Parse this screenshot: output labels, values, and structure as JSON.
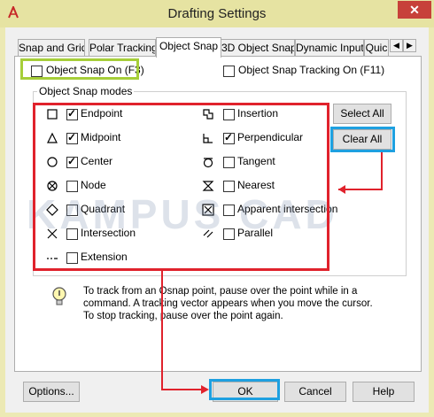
{
  "window": {
    "title": "Drafting Settings",
    "close_glyph": "✕"
  },
  "tabs": [
    {
      "label": "Snap and Grid"
    },
    {
      "label": "Polar Tracking"
    },
    {
      "label": "Object Snap"
    },
    {
      "label": "3D Object Snap"
    },
    {
      "label": "Dynamic Input"
    },
    {
      "label": "Quic"
    }
  ],
  "tab_scroll": {
    "left": "◀",
    "right": "▶"
  },
  "object_snap_on": {
    "label": "Object Snap On (F3)",
    "checked": false
  },
  "object_snap_tracking": {
    "label": "Object Snap Tracking On (F11)",
    "checked": false
  },
  "modes_group_title": "Object Snap modes",
  "modes_left": [
    {
      "label": "Endpoint",
      "checked": true,
      "icon": "square-marker"
    },
    {
      "label": "Midpoint",
      "checked": true,
      "icon": "triangle-marker"
    },
    {
      "label": "Center",
      "checked": true,
      "icon": "circle-marker"
    },
    {
      "label": "Node",
      "checked": false,
      "icon": "node-marker"
    },
    {
      "label": "Quadrant",
      "checked": false,
      "icon": "diamond-marker"
    },
    {
      "label": "Intersection",
      "checked": false,
      "icon": "x-marker"
    },
    {
      "label": "Extension",
      "checked": false,
      "icon": "extension-marker"
    }
  ],
  "modes_right": [
    {
      "label": "Insertion",
      "checked": false,
      "icon": "insertion-marker"
    },
    {
      "label": "Perpendicular",
      "checked": true,
      "icon": "perpendicular-marker"
    },
    {
      "label": "Tangent",
      "checked": false,
      "icon": "tangent-marker"
    },
    {
      "label": "Nearest",
      "checked": false,
      "icon": "nearest-marker"
    },
    {
      "label": "Apparent intersection",
      "checked": false,
      "icon": "apparent-intersection-marker"
    },
    {
      "label": "Parallel",
      "checked": false,
      "icon": "parallel-marker"
    }
  ],
  "buttons": {
    "select_all": "Select All",
    "clear_all": "Clear All",
    "options": "Options...",
    "ok": "OK",
    "cancel": "Cancel",
    "help": "Help"
  },
  "info_text": "To track from an Osnap point, pause over the point while in a command.  A tracking vector appears when you move the cursor. To stop tracking, pause over the point again.",
  "watermark": "KAMPUS CAD",
  "colors": {
    "highlight_green": "#a6ce39",
    "highlight_red": "#e0222c",
    "highlight_blue": "#1ea0e0",
    "close_red": "#c7413a"
  }
}
